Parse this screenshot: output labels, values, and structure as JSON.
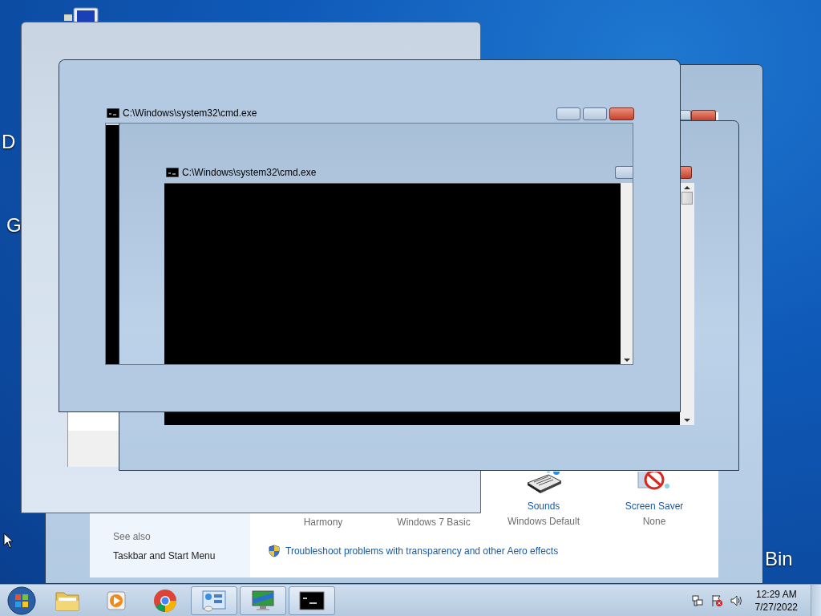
{
  "desktop": {
    "icon_labels": [
      {
        "text": "D",
        "kind": "left-upper"
      },
      {
        "text": "G",
        "kind": "left-lower"
      },
      {
        "text": "Bin",
        "kind": "right"
      }
    ]
  },
  "personalization_window": {
    "see_also": "See also",
    "see_also_links": [
      "Taskbar and Start Menu"
    ],
    "themes": [
      "Harmony",
      "Windows 7 Basic"
    ],
    "settings": [
      {
        "label": "Sounds",
        "value": "Windows Default",
        "kind": "sounds"
      },
      {
        "label": "Screen Saver",
        "value": "None",
        "kind": "screensaver"
      }
    ],
    "troubleshoot_link": "Troubleshoot problems with transparency and other Aero effects"
  },
  "console_windows": [
    {
      "title": "C:\\Windows\\system32\\cmd.exe"
    },
    {
      "title": "C:\\Windows\\system32\\cmd.exe"
    }
  ],
  "taskbar": {
    "items": [
      {
        "kind": "folder",
        "running": false
      },
      {
        "kind": "player",
        "running": false
      },
      {
        "kind": "browser",
        "running": false
      },
      {
        "kind": "panel",
        "running": true
      },
      {
        "kind": "monitor",
        "running": true
      },
      {
        "kind": "console",
        "running": true
      }
    ],
    "clock": {
      "time": "12:29 AM",
      "date": "7/27/2022"
    }
  }
}
